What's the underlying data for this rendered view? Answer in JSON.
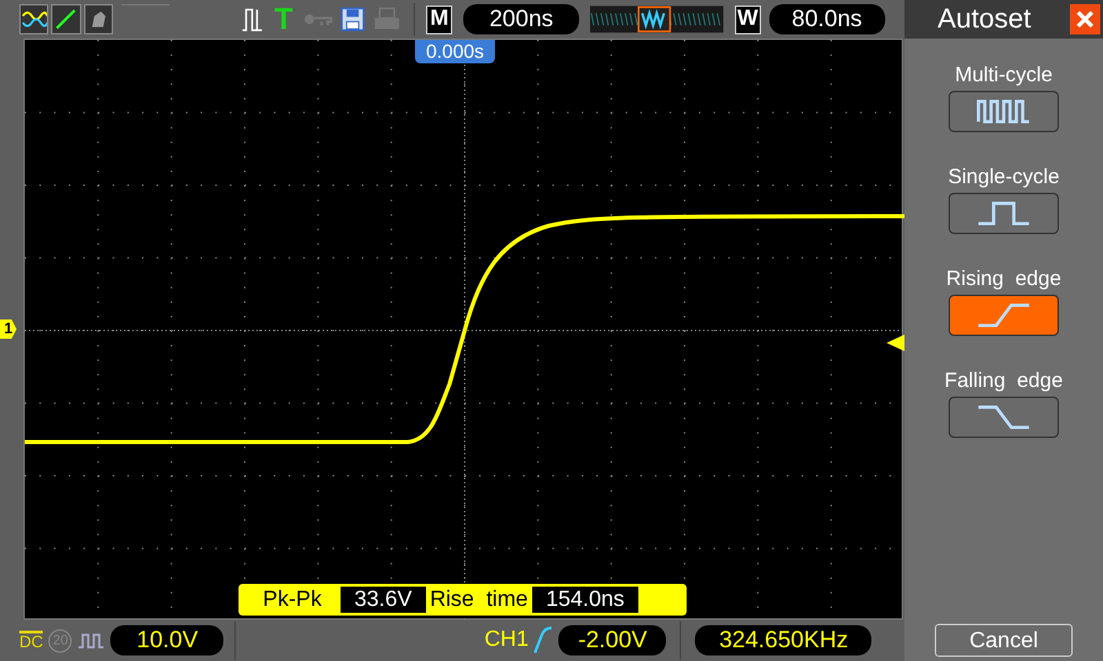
{
  "toolbar": {
    "trigger_label": "T",
    "main_label": "M",
    "timebase": "200ns",
    "window_label": "W",
    "window_timebase": "80.0ns"
  },
  "screen": {
    "trigger_position": "0.000s",
    "channel_marker": "1",
    "measurements": [
      {
        "label": "Pk-Pk",
        "value": "33.6V"
      },
      {
        "label": "Rise  time",
        "value": "154.0ns"
      }
    ]
  },
  "status_bar": {
    "coupling": "DC",
    "bandwidth_limit": "20",
    "volts_per_div": "10.0V",
    "trigger_source": "CH1",
    "trigger_level": "-2.00V",
    "frequency": "324.650KHz"
  },
  "autoset": {
    "title": "Autoset",
    "options": [
      {
        "label": "Multi-cycle",
        "kind": "multi",
        "selected": false
      },
      {
        "label": "Single-cycle",
        "kind": "single",
        "selected": false
      },
      {
        "label": "Rising  edge",
        "kind": "rising",
        "selected": true
      },
      {
        "label": "Falling  edge",
        "kind": "falling",
        "selected": false
      }
    ],
    "cancel": "Cancel"
  }
}
